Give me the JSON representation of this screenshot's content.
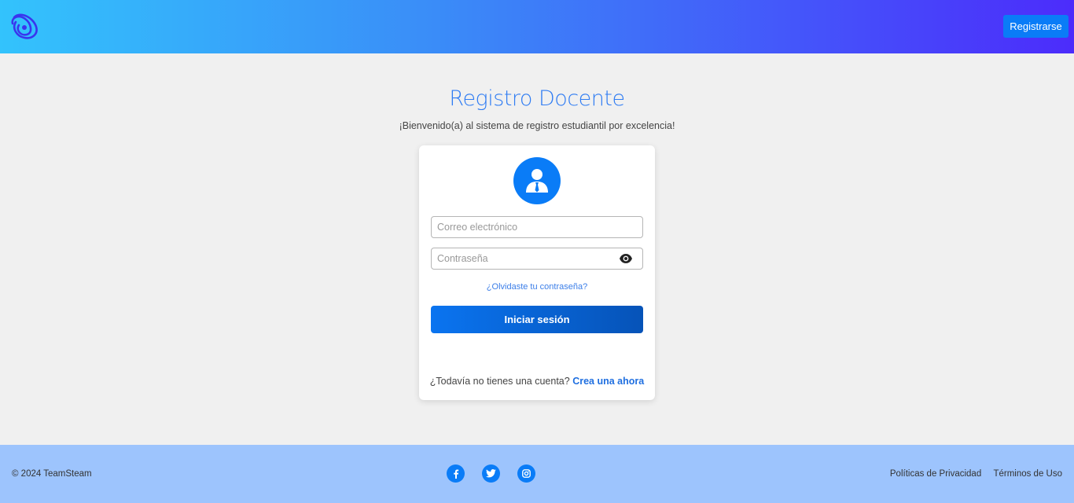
{
  "navbar": {
    "register_label": "Registrarse",
    "gradient": [
      "#33c3fc",
      "#4c2cfb"
    ]
  },
  "main": {
    "title": "Registro Docente",
    "welcome": "¡Bienvenido(a) al sistema de registro estudiantil por excelencia!"
  },
  "login": {
    "email_placeholder": "Correo electrónico",
    "password_placeholder": "Contraseña",
    "forgot_label": "¿Olvidaste tu contraseña?",
    "submit_label": "Iniciar sesión",
    "no_account_text": "¿Todavía no tienes una cuenta?",
    "signup_link": "Crea una ahora",
    "accent_color": "#0a7cf7"
  },
  "footer": {
    "copyright": "© 2024 TeamSteam",
    "social": [
      "facebook-icon",
      "twitter-icon",
      "instagram-icon"
    ],
    "links": [
      "Políticas de Privacidad",
      "Términos de Uso"
    ]
  }
}
